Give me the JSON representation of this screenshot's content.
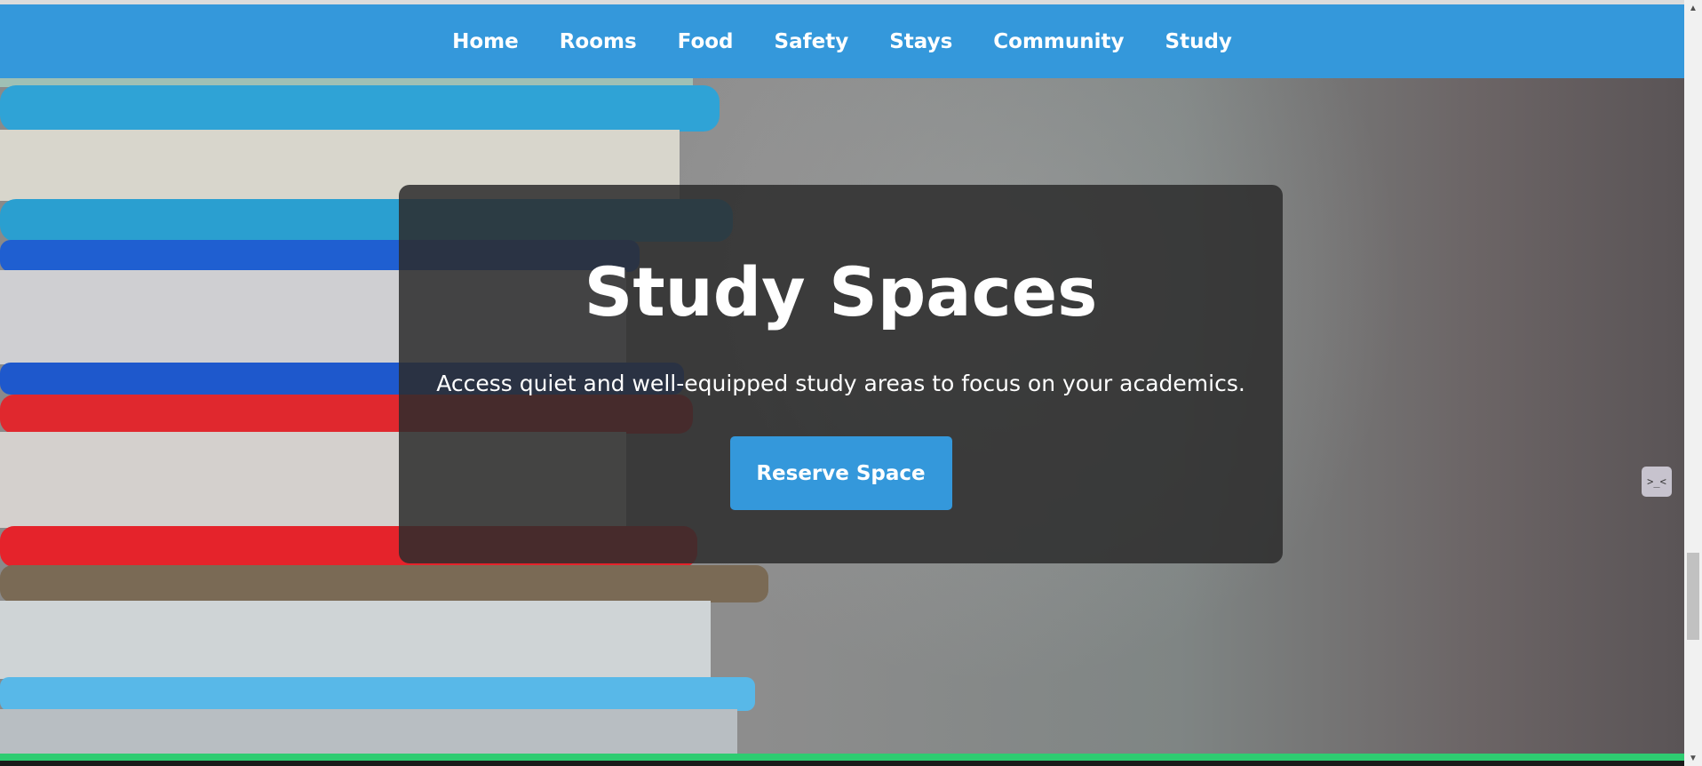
{
  "nav": {
    "items": [
      {
        "label": "Home"
      },
      {
        "label": "Rooms"
      },
      {
        "label": "Food"
      },
      {
        "label": "Safety"
      },
      {
        "label": "Stays"
      },
      {
        "label": "Community"
      },
      {
        "label": "Study"
      }
    ]
  },
  "hero": {
    "title": "Study Spaces",
    "subtitle": "Access quiet and well-equipped study areas to focus on your academics.",
    "cta_label": "Reserve Space",
    "background_image": "stack-of-books-photo"
  },
  "side_widget": {
    "glyph": ">_<",
    "icon": "assistant-face-icon"
  },
  "scrollbar": {
    "up": "▲",
    "down": "▼"
  },
  "colors": {
    "nav_background": "#3498db",
    "cta_background": "#3498db",
    "card_background": "#2c2c2c",
    "footer_accent": "#2ecc71"
  }
}
